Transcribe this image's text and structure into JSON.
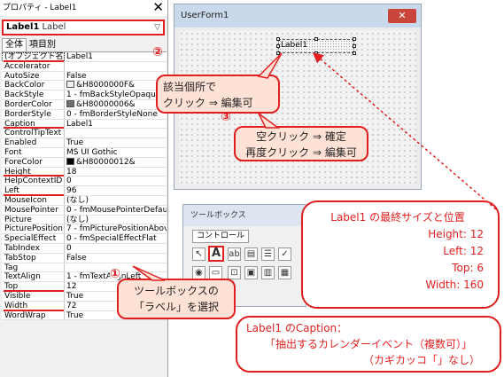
{
  "properties": {
    "title": "プロパティ - Label1",
    "close_glyph": "✕",
    "object_name": "Label1",
    "object_type": "Label",
    "dropdown_glyph": "▽",
    "tabs": [
      "全体",
      "項目別"
    ],
    "rows": [
      {
        "name": "(オブジェクト名)",
        "value": "Label1"
      },
      {
        "name": "Accelerator",
        "value": ""
      },
      {
        "name": "AutoSize",
        "value": "False"
      },
      {
        "name": "BackColor",
        "value": "&H8000000F&"
      },
      {
        "name": "BackStyle",
        "value": "1 - fmBackStyleOpaque"
      },
      {
        "name": "BorderColor",
        "value": "&H80000006&"
      },
      {
        "name": "BorderStyle",
        "value": "0 - fmBorderStyleNone"
      },
      {
        "name": "Caption",
        "value": "Label1"
      },
      {
        "name": "ControlTipText",
        "value": ""
      },
      {
        "name": "Enabled",
        "value": "True"
      },
      {
        "name": "Font",
        "value": "MS UI Gothic"
      },
      {
        "name": "ForeColor",
        "value": "&H80000012&"
      },
      {
        "name": "Height",
        "value": "18"
      },
      {
        "name": "HelpContextID",
        "value": "0"
      },
      {
        "name": "Left",
        "value": "96"
      },
      {
        "name": "MouseIcon",
        "value": "(なし)"
      },
      {
        "name": "MousePointer",
        "value": "0 - fmMousePointerDefault"
      },
      {
        "name": "Picture",
        "value": "(なし)"
      },
      {
        "name": "PicturePosition",
        "value": "7 - fmPicturePositionAbove"
      },
      {
        "name": "SpecialEffect",
        "value": "0 - fmSpecialEffectFlat"
      },
      {
        "name": "TabIndex",
        "value": "0"
      },
      {
        "name": "TabStop",
        "value": "False"
      },
      {
        "name": "Tag",
        "value": ""
      },
      {
        "name": "TextAlign",
        "value": "1 - fmTextAlignLeft"
      },
      {
        "name": "Top",
        "value": "12"
      },
      {
        "name": "Visible",
        "value": "True"
      },
      {
        "name": "Width",
        "value": "72"
      },
      {
        "name": "WordWrap",
        "value": "True"
      }
    ]
  },
  "colors": {
    "back": "#f0f0f0",
    "border": "#6e6e6e",
    "fore": "#000000",
    "accent": "#e02020"
  },
  "userform": {
    "title": "UserForm1",
    "close_glyph": "✕",
    "label_caption": "Label1"
  },
  "toolbox": {
    "title": "ツールボックス",
    "tab": "コントロール",
    "label_tool_glyph": "A"
  },
  "callouts": {
    "c1_num": "①",
    "c1_line1": "ツールボックスの",
    "c1_line2": "「ラベル」を選択",
    "c2_num": "②",
    "c2_line1": "該当個所で",
    "c2_line2": "クリック ⇒ 編集可",
    "c3_num": "③",
    "c3_line1": "空クリック ⇒ 確定",
    "c3_line2": "再度クリック ⇒ 編集可"
  },
  "info_size": {
    "heading": "Label1 の最終サイズと位置",
    "height": "Height:  12",
    "left": "Left:  12",
    "top": "Top:   6",
    "width": "Width: 160"
  },
  "info_caption": {
    "line1": "Label1 のCaption：",
    "line2": "「抽出するカレンダーイベント（複数可）」",
    "line3": "（カギカッコ「」なし）"
  }
}
